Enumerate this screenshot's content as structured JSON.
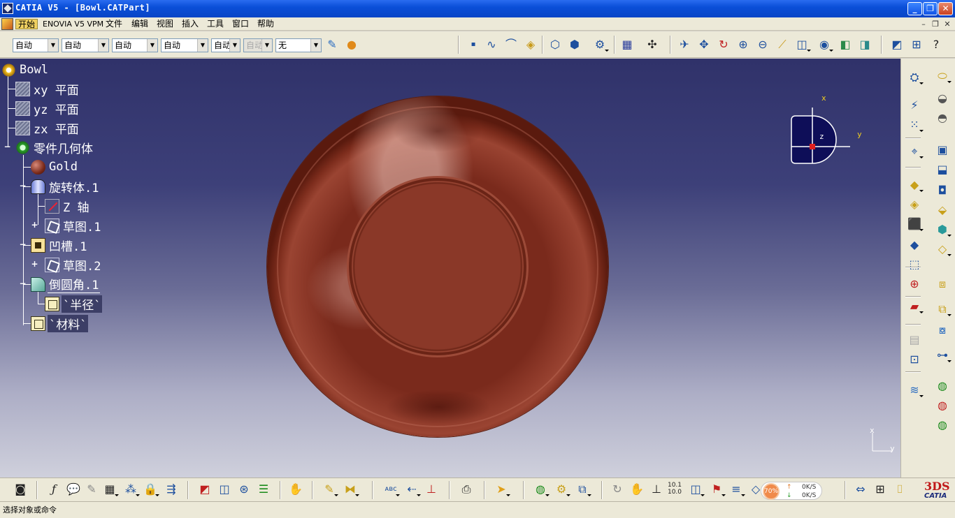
{
  "window": {
    "title": "CATIA V5 - [Bowl.CATPart]",
    "minimize": "_",
    "restore": "❐",
    "close": "✕"
  },
  "menu": {
    "items": [
      "开始",
      "ENOVIA V5 VPM",
      "文件",
      "编辑",
      "视图",
      "插入",
      "工具",
      "窗口",
      "帮助"
    ],
    "mdi_min": "–",
    "mdi_restore": "❐",
    "mdi_close": "✕"
  },
  "toolbar_top": {
    "combos": [
      "自动",
      "自动",
      "自动",
      "自动",
      "自动",
      "自动",
      "无"
    ]
  },
  "tree": {
    "root": "Bowl",
    "planes": [
      "xy 平面",
      "yz 平面",
      "zx 平面"
    ],
    "body": "零件几何体",
    "material": "Gold",
    "revolve": "旋转体.1",
    "axis": "Z 轴",
    "sketch1": "草图.1",
    "pocket": "凹槽.1",
    "sketch2": "草图.2",
    "fillet": "倒圆角.1",
    "radius_param": "`半径`",
    "material_param": "`材料`"
  },
  "compass": {
    "x": "x",
    "y": "y",
    "z": "z"
  },
  "mini_axis": {
    "x": "x",
    "y": "y"
  },
  "progress": {
    "percent_label": "70%",
    "up_arrow": "↑",
    "down_arrow": "↓",
    "up_value": "0K/S",
    "down_value": "0K/S"
  },
  "logo": {
    "mark": "3DS",
    "text": "CATIA"
  },
  "status": {
    "prompt": "选择对象或命令"
  },
  "colors": {
    "titlebar": "#0a4fd8",
    "viewport_top": "#30326a",
    "viewport_bottom": "#cfd0dc",
    "bowl": "#8a3828",
    "compass_fill": "#0e0e58",
    "progress": "#f08a4a"
  }
}
